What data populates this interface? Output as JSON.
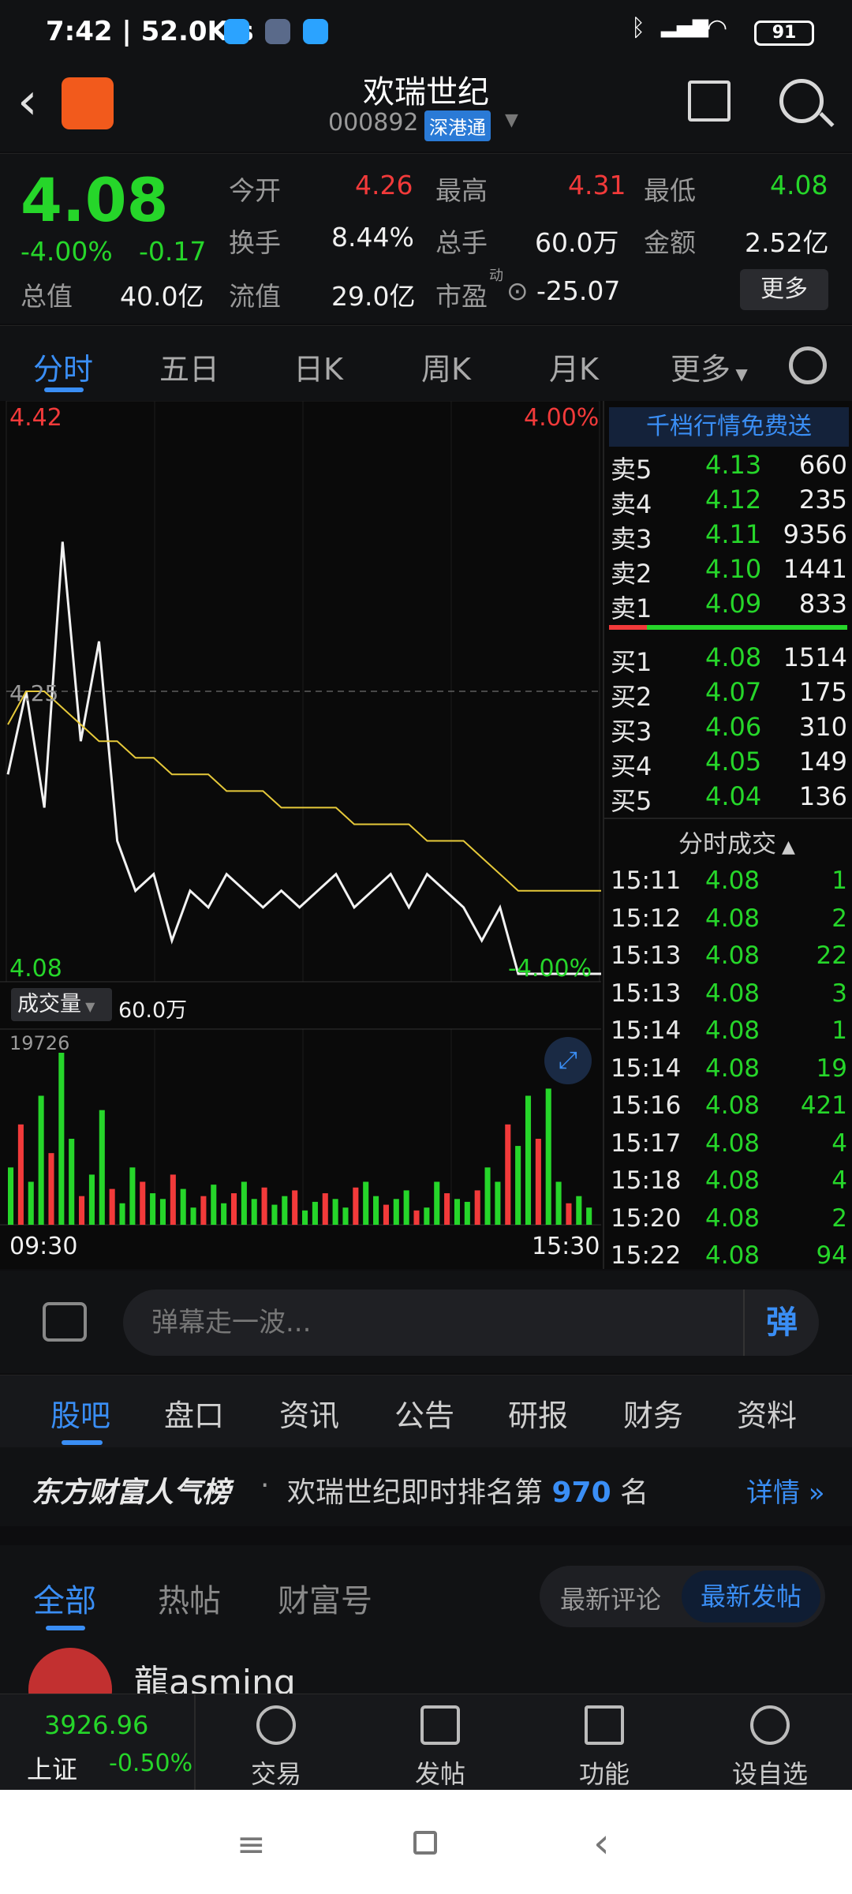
{
  "status_bar": {
    "time": "7:42",
    "speed": "52.0K/s",
    "battery": "91"
  },
  "header": {
    "title": "欢瑞世纪",
    "code": "000892",
    "tag": "深港通"
  },
  "quote": {
    "price": "4.08",
    "change_pct": "-4.00%",
    "change_amt": "-0.17",
    "open_label": "今开",
    "open": "4.26",
    "high_label": "最高",
    "high": "4.31",
    "low_label": "最低",
    "low": "4.08",
    "turnover_label": "换手",
    "turnover": "8.44%",
    "volume_label": "总手",
    "volume": "60.0万",
    "amount_label": "金额",
    "amount": "2.52亿",
    "mktcap_label": "总值",
    "mktcap": "40.0亿",
    "float_label": "流值",
    "float": "29.0亿",
    "pe_label": "市盈",
    "pe_sup": "动",
    "pe": "-25.07",
    "more_button": "更多"
  },
  "chart_tabs": [
    "分时",
    "五日",
    "日K",
    "周K",
    "月K",
    "更多"
  ],
  "chart": {
    "top_price": "4.42",
    "top_pct": "4.00%",
    "ref_price": "4.25",
    "bottom_price": "4.08",
    "bottom_pct": "-4.00%",
    "volume_selector": "成交量",
    "volume_value": "60.0万",
    "volume_max": "19726",
    "time_start": "09:30",
    "time_end": "15:30"
  },
  "chart_data": {
    "type": "line",
    "series": [
      {
        "values": [
          4.2,
          4.25,
          4.18,
          4.34,
          4.22,
          4.28,
          4.16,
          4.13,
          4.14,
          4.1,
          4.13,
          4.12,
          4.14,
          4.13,
          4.12,
          4.13,
          4.12,
          4.13,
          4.14,
          4.12,
          4.13,
          4.14,
          4.12,
          4.14,
          4.13,
          4.12,
          4.1,
          4.12,
          4.08,
          4.08
        ]
      },
      {
        "values": [
          4.23,
          4.25,
          4.25,
          4.24,
          4.23,
          4.22,
          4.22,
          4.21,
          4.21,
          4.2,
          4.2,
          4.2,
          4.19,
          4.19,
          4.19,
          4.18,
          4.18,
          4.18,
          4.18,
          4.17,
          4.17,
          4.17,
          4.17,
          4.16,
          4.16,
          4.16,
          4.15,
          4.14,
          4.13,
          4.13
        ]
      }
    ],
    "ylim": [
      4.08,
      4.42
    ],
    "volume_bars": [
      40,
      70,
      30,
      90,
      50,
      120,
      60,
      20,
      35,
      80,
      25,
      15,
      40,
      30,
      22,
      18,
      35,
      25,
      12,
      20,
      28,
      15,
      22,
      30,
      18,
      26,
      14,
      20,
      24,
      10,
      16,
      22,
      18,
      12,
      26,
      30,
      20,
      14,
      18,
      24,
      10,
      12,
      30,
      22,
      18,
      16,
      24,
      40,
      30,
      70,
      55,
      90,
      60,
      95,
      30,
      15,
      20,
      12
    ]
  },
  "order_book": {
    "banner": "千档行情免费送",
    "asks": [
      {
        "label": "卖5",
        "price": "4.13",
        "vol": "660"
      },
      {
        "label": "卖4",
        "price": "4.12",
        "vol": "235"
      },
      {
        "label": "卖3",
        "price": "4.11",
        "vol": "9356"
      },
      {
        "label": "卖2",
        "price": "4.10",
        "vol": "1441"
      },
      {
        "label": "卖1",
        "price": "4.09",
        "vol": "833"
      }
    ],
    "bids": [
      {
        "label": "买1",
        "price": "4.08",
        "vol": "1514"
      },
      {
        "label": "买2",
        "price": "4.07",
        "vol": "175"
      },
      {
        "label": "买3",
        "price": "4.06",
        "vol": "310"
      },
      {
        "label": "买4",
        "price": "4.05",
        "vol": "149"
      },
      {
        "label": "买5",
        "price": "4.04",
        "vol": "136"
      }
    ],
    "trades_title": "分时成交",
    "trades": [
      {
        "t": "15:11",
        "p": "4.08",
        "v": "1"
      },
      {
        "t": "15:12",
        "p": "4.08",
        "v": "2"
      },
      {
        "t": "15:13",
        "p": "4.08",
        "v": "22"
      },
      {
        "t": "15:13",
        "p": "4.08",
        "v": "3"
      },
      {
        "t": "15:14",
        "p": "4.08",
        "v": "1"
      },
      {
        "t": "15:14",
        "p": "4.08",
        "v": "19"
      },
      {
        "t": "15:16",
        "p": "4.08",
        "v": "421"
      },
      {
        "t": "15:17",
        "p": "4.08",
        "v": "4"
      },
      {
        "t": "15:18",
        "p": "4.08",
        "v": "4"
      },
      {
        "t": "15:20",
        "p": "4.08",
        "v": "2"
      },
      {
        "t": "15:22",
        "p": "4.08",
        "v": "94"
      }
    ]
  },
  "danmu": {
    "placeholder": "弹幕走一波...",
    "button": "弹"
  },
  "sub_tabs": [
    "股吧",
    "盘口",
    "资讯",
    "公告",
    "研报",
    "财务",
    "资料"
  ],
  "rank": {
    "brand": "东方财富人气榜",
    "text_pre": "欢瑞世纪即时排名第",
    "rank": "970",
    "text_post": "名",
    "detail": "详情"
  },
  "feed_tabs": {
    "all": "全部",
    "hot": "热帖",
    "wealth": "财富号",
    "latest_comment": "最新评论",
    "latest_post": "最新发帖"
  },
  "post_peek": {
    "user": "龍asming"
  },
  "bottom_nav": {
    "index_value": "3926.96",
    "index_name": "上证",
    "index_change": "-0.50%",
    "items": [
      "交易",
      "发帖",
      "功能",
      "设自选"
    ]
  }
}
